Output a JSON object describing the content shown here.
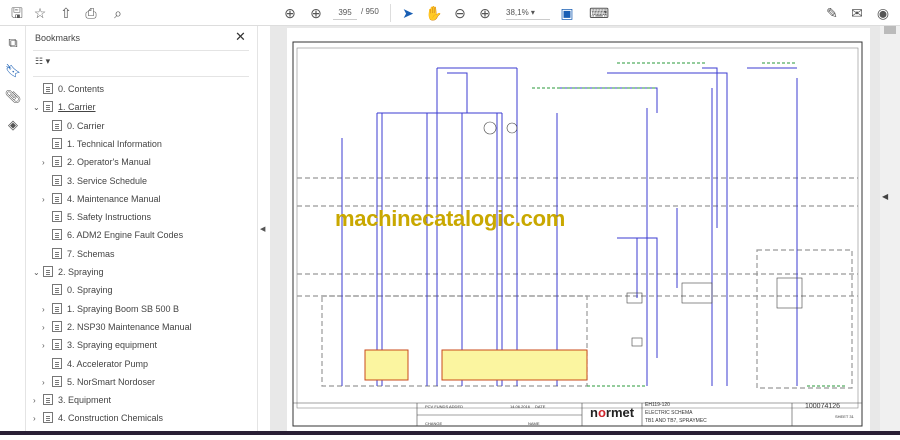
{
  "toolbar": {
    "page_current": "395",
    "page_total": "/ 950",
    "zoom": "38,1%"
  },
  "bookmarks": {
    "title": "Bookmarks",
    "close": "✕",
    "options": "☷ ▾",
    "items": [
      {
        "label": "0. Contents",
        "level": 0,
        "chev": ""
      },
      {
        "label": "1. Carrier",
        "level": 0,
        "chev": "⌄"
      },
      {
        "label": "0. Carrier",
        "level": 1,
        "chev": ""
      },
      {
        "label": "1. Technical Information",
        "level": 1,
        "chev": ""
      },
      {
        "label": "2. Operator's Manual",
        "level": 1,
        "chev": "›"
      },
      {
        "label": "3. Service Schedule",
        "level": 1,
        "chev": ""
      },
      {
        "label": "4. Maintenance Manual",
        "level": 1,
        "chev": "›"
      },
      {
        "label": "5. Safety Instructions",
        "level": 1,
        "chev": ""
      },
      {
        "label": "6. ADM2 Engine Fault Codes",
        "level": 1,
        "chev": ""
      },
      {
        "label": "7. Schemas",
        "level": 1,
        "chev": ""
      },
      {
        "label": "2. Spraying",
        "level": 0,
        "chev": "⌄"
      },
      {
        "label": "0. Spraying",
        "level": 1,
        "chev": ""
      },
      {
        "label": "1. Spraying Boom SB 500 B",
        "level": 1,
        "chev": "›"
      },
      {
        "label": "2. NSP30 Maintenance Manual",
        "level": 1,
        "chev": "›"
      },
      {
        "label": "3. Spraying equipment",
        "level": 1,
        "chev": "›"
      },
      {
        "label": "4. Accelerator Pump",
        "level": 1,
        "chev": ""
      },
      {
        "label": "5. NorSmart Nordoser",
        "level": 1,
        "chev": "›"
      },
      {
        "label": "3. Equipment",
        "level": 0,
        "chev": "›"
      },
      {
        "label": "4. Construction Chemicals",
        "level": 0,
        "chev": "›"
      }
    ]
  },
  "document": {
    "watermark": "machinecatalogic.com",
    "title_block": {
      "logo": "normet",
      "code": "EH119-120",
      "title": "ELECTRIC SCHEMA",
      "subtitle": "TB1 AND TB7, SPRAYMEC",
      "number": "100074126",
      "date_label": "DATE",
      "date": "14.06.2016",
      "sheet": "SHEET 31",
      "pcv": "PCV FUNDS ADDED",
      "name": "NAME",
      "change": "CHANGE"
    }
  }
}
